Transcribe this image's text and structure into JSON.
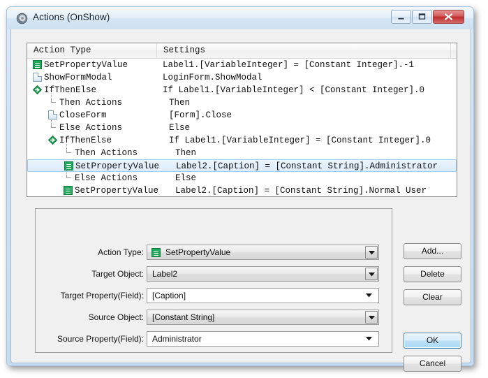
{
  "window": {
    "title": "Actions (OnShow)",
    "icon": "app-gear-disc-icon",
    "minimize_label": "Minimize",
    "maximize_label": "Maximize",
    "close_label": "Close"
  },
  "list": {
    "columns": [
      "Action Type",
      "Settings",
      ""
    ],
    "rows": [
      {
        "label": "SetPropertyValue",
        "settings": "Label1.[VariableInteger] = [Constant Integer].-1",
        "icon": "property-icon",
        "indent": 0,
        "selected": false
      },
      {
        "label": "ShowFormModal",
        "settings": "LoginForm.ShowModal",
        "icon": "document-icon",
        "indent": 0,
        "selected": false
      },
      {
        "label": "IfThenElse",
        "settings": "If Label1.[VariableInteger] < [Constant Integer].0",
        "icon": "branch-icon",
        "indent": 0,
        "selected": false
      },
      {
        "label": "Then Actions",
        "settings": "Then",
        "icon": "elbow-icon",
        "indent": 1,
        "selected": false
      },
      {
        "label": "CloseForm",
        "settings": "[Form].Close",
        "icon": "document-icon",
        "indent": 1,
        "selected": false
      },
      {
        "label": "Else Actions",
        "settings": "Else",
        "icon": "elbow-icon",
        "indent": 1,
        "selected": false
      },
      {
        "label": "IfThenElse",
        "settings": "If Label1.[VariableInteger] = [Constant Integer].0",
        "icon": "branch-icon",
        "indent": 1,
        "selected": false
      },
      {
        "label": "Then Actions",
        "settings": "Then",
        "icon": "elbow-icon",
        "indent": 2,
        "selected": false
      },
      {
        "label": "SetPropertyValue",
        "settings": "Label2.[Caption] = [Constant String].Administrator",
        "icon": "property-icon",
        "indent": 2,
        "selected": true
      },
      {
        "label": "Else Actions",
        "settings": "Else",
        "icon": "elbow-icon",
        "indent": 2,
        "selected": false
      },
      {
        "label": "SetPropertyValue",
        "settings": "Label2.[Caption] = [Constant String].Normal User",
        "icon": "property-icon",
        "indent": 2,
        "selected": false
      }
    ]
  },
  "form": {
    "fields": [
      {
        "label": "Action Type:",
        "value": "SetPropertyValue",
        "style": "combo",
        "icon": "property-icon"
      },
      {
        "label": "Target Object:",
        "value": "Label2",
        "style": "combo",
        "icon": null
      },
      {
        "label": "Target Property(Field):",
        "value": "[Caption]",
        "style": "plain",
        "icon": null
      },
      {
        "label": "Source Object:",
        "value": "[Constant String]",
        "style": "combo",
        "icon": null
      },
      {
        "label": "Source Property(Field):",
        "value": "Administrator",
        "style": "plain",
        "icon": null
      }
    ]
  },
  "buttons": {
    "add": "Add...",
    "delete": "Delete",
    "clear": "Clear",
    "ok": "OK",
    "cancel": "Cancel"
  },
  "colors": {
    "accent": "#1faa59",
    "selection": "#dcebfb",
    "selection_border": "#a8cced",
    "close_button": "#bf2c2c",
    "focus_border": "#3c7fb1"
  }
}
